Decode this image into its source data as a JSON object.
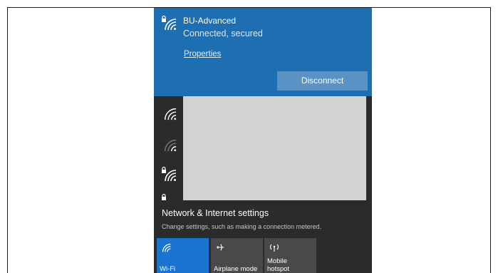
{
  "connected_network": {
    "name": "BU-Advanced",
    "status": "Connected, secured",
    "properties_link": "Properties",
    "disconnect_label": "Disconnect"
  },
  "network_list": {
    "icons": [
      "wifi-icon",
      "wifi-weak-icon",
      "wifi-secured-icon",
      "wifi-secured-icon"
    ]
  },
  "settings": {
    "title": "Network & Internet settings",
    "subtitle": "Change settings, such as making a connection metered."
  },
  "quick_actions": [
    {
      "label": "Wi-Fi",
      "icon": "wifi-icon",
      "active": true
    },
    {
      "label": "Airplane mode",
      "icon": "airplane-icon",
      "active": false
    },
    {
      "label": "Mobile\nhotspot",
      "icon": "hotspot-icon",
      "active": false
    }
  ],
  "colors": {
    "accent": "#1d6fb2",
    "panel": "#2b2b2b",
    "active_tile": "#1a74cf",
    "inactive_tile": "#494949"
  }
}
